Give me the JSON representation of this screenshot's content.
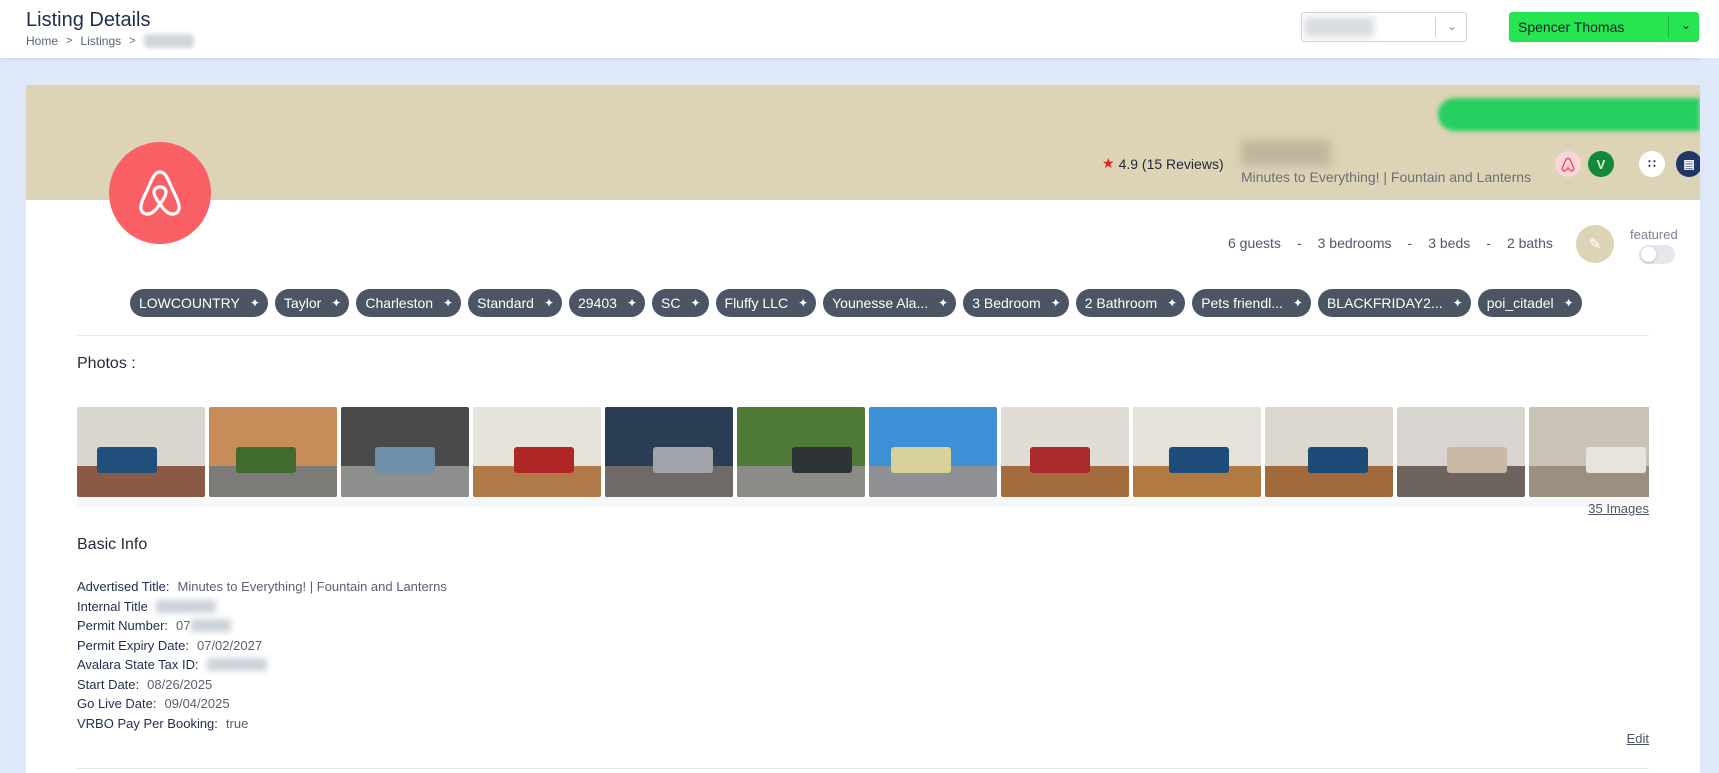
{
  "header": {
    "title": "Listing Details",
    "breadcrumb": [
      "Home",
      "Listings"
    ],
    "user_name": "Spencer Thomas"
  },
  "listing": {
    "rating": "4.9 (15 Reviews)",
    "subtitle": "Minutes to Everything! | Fountain and Lanterns",
    "guests": "6 guests",
    "bedrooms": "3 bedrooms",
    "beds": "3 beds",
    "baths": "2 baths",
    "dash": "-",
    "featured_label": "featured",
    "featured": false
  },
  "tags": [
    "LOWCOUNTRY",
    "Taylor",
    "Charleston",
    "Standard",
    "29403",
    "SC",
    "Fluffy LLC",
    "Younesse Ala...",
    "3 Bedroom",
    "2 Bathroom",
    "Pets friendl...",
    "BLACKFRIDAY2...",
    "poi_citadel"
  ],
  "photos": {
    "title": "Photos :",
    "count_link": "35 Images",
    "items": [
      {
        "name": "living-room-photo",
        "bg": "#d9d6cf",
        "floor": "#8a5a45",
        "accent": "#1f4f7a"
      },
      {
        "name": "patio-photo",
        "bg": "#c88b5a",
        "floor": "#7c7b78",
        "accent": "#3f6b2e"
      },
      {
        "name": "gazebo-photo",
        "bg": "#4a4a48",
        "floor": "#8c8f8c",
        "accent": "#6e8fa8"
      },
      {
        "name": "dining-room-photo",
        "bg": "#e6e2dc",
        "floor": "#b07a48",
        "accent": "#b02525"
      },
      {
        "name": "kitchen-photo",
        "bg": "#2a3d55",
        "floor": "#6f6a66",
        "accent": "#a0a4aa"
      },
      {
        "name": "backyard-shed-photo",
        "bg": "#4e7a35",
        "floor": "#8b8b88",
        "accent": "#2e3338"
      },
      {
        "name": "exterior-photo",
        "bg": "#3d8fd6",
        "floor": "#8f9094",
        "accent": "#d9d19a"
      },
      {
        "name": "dining-area-photo",
        "bg": "#e1ddd6",
        "floor": "#a36c3c",
        "accent": "#a82a2a"
      },
      {
        "name": "lounge-photo",
        "bg": "#e5e2dc",
        "floor": "#b17a42",
        "accent": "#1e4d7c"
      },
      {
        "name": "family-room-photo",
        "bg": "#dcd8d0",
        "floor": "#a06a3d",
        "accent": "#1d4a77"
      },
      {
        "name": "kitchen-range-photo",
        "bg": "#d8d5d0",
        "floor": "#6d6460",
        "accent": "#c9b9a4"
      },
      {
        "name": "kitchen-sink-photo",
        "bg": "#c9c3b6",
        "floor": "#9a8f80",
        "accent": "#e8e4dc"
      }
    ]
  },
  "basic_info": {
    "title": "Basic Info",
    "advertised_title_label": "Advertised Title:",
    "advertised_title": "Minutes to Everything! | Fountain and Lanterns",
    "internal_title_label": "Internal Title",
    "permit_number_label": "Permit Number:",
    "permit_number_partial": "07",
    "permit_expiry_label": "Permit Expiry Date:",
    "permit_expiry": "07/02/2027",
    "avalara_label": "Avalara State Tax ID:",
    "start_date_label": "Start Date:",
    "start_date": "08/26/2025",
    "go_live_label": "Go Live Date:",
    "go_live": "09/04/2025",
    "vrbo_label": "VRBO Pay Per Booking:",
    "vrbo_value": "true",
    "edit_label": "Edit"
  },
  "colors": {
    "banner": "#ddd3b6",
    "airbnb": "#fb5f66",
    "user_button": "#27e451",
    "tag": "#4b5563"
  }
}
